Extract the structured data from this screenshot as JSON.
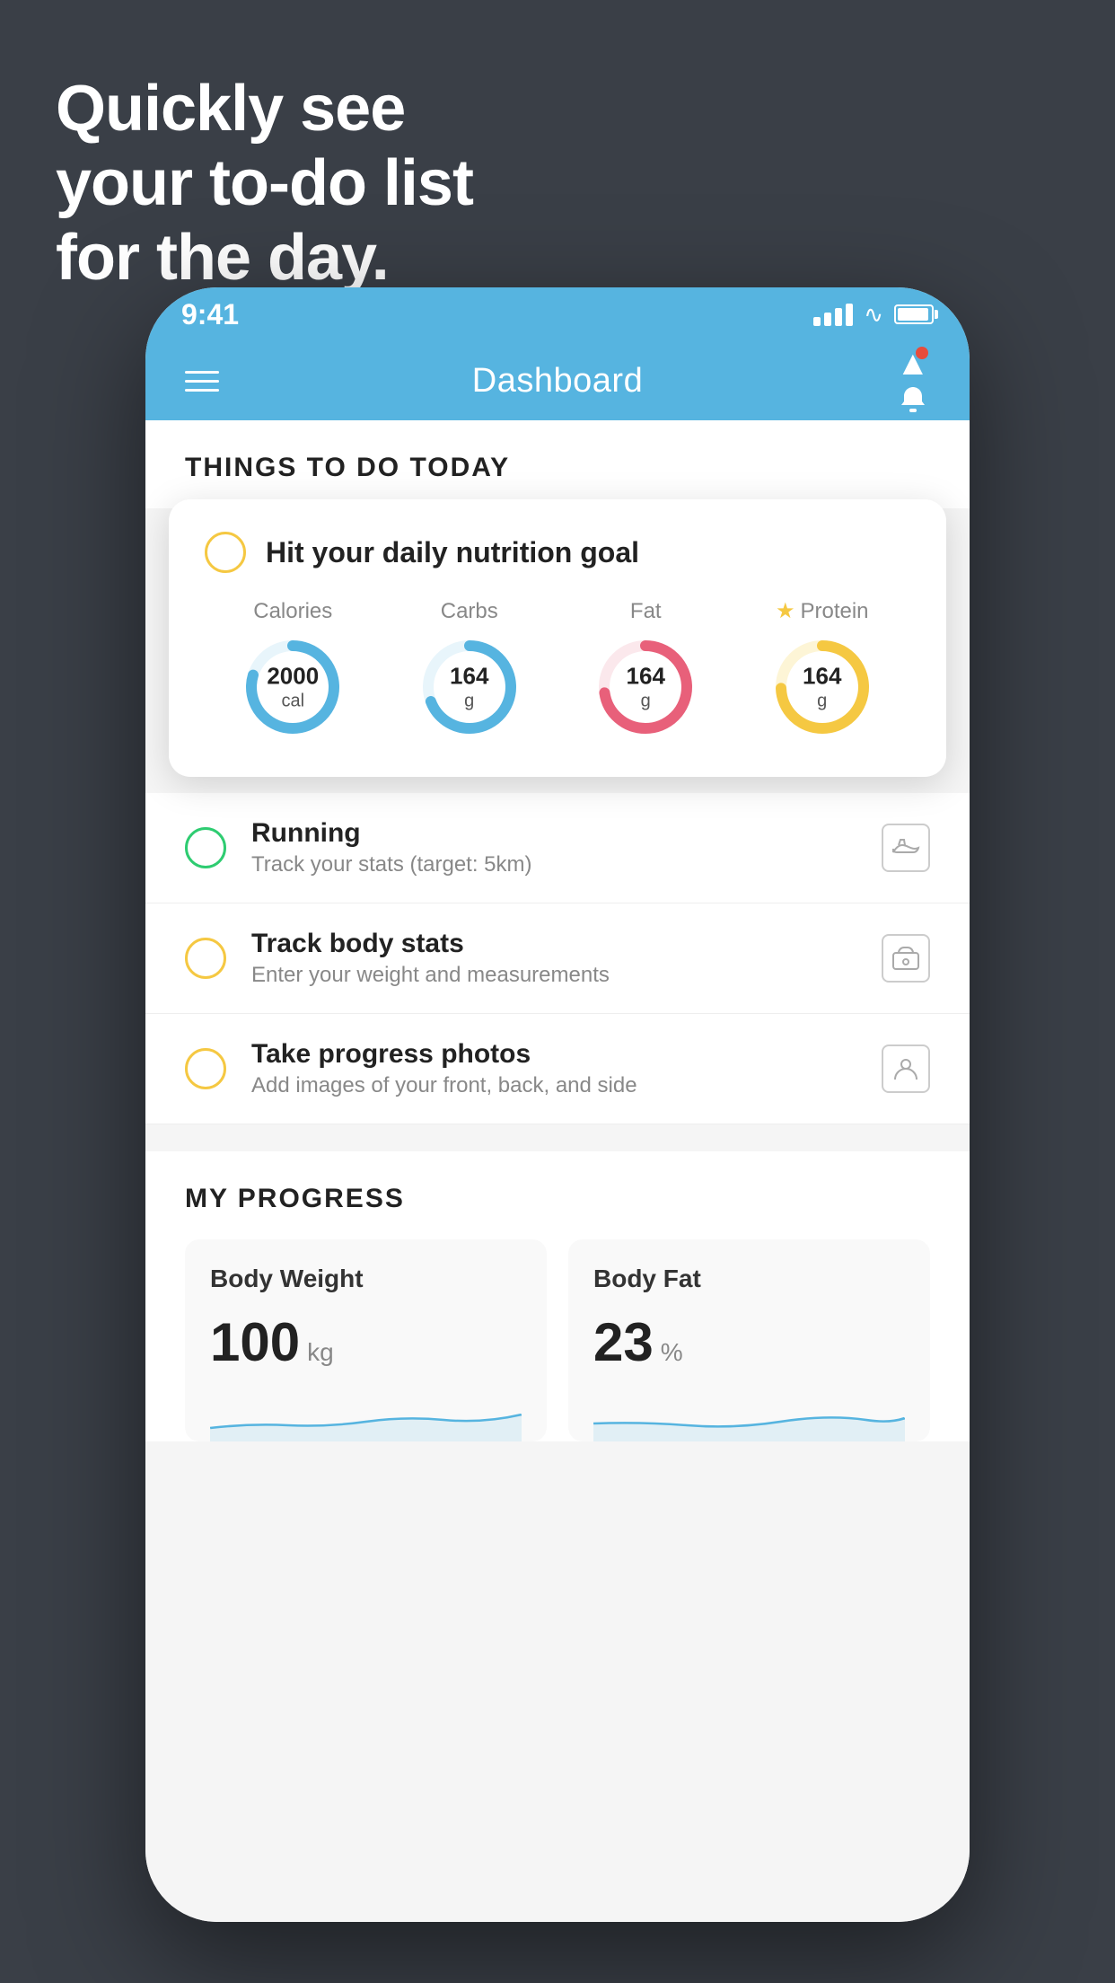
{
  "headline": {
    "line1": "Quickly see",
    "line2": "your to-do list",
    "line3": "for the day."
  },
  "statusBar": {
    "time": "9:41"
  },
  "header": {
    "title": "Dashboard"
  },
  "thingsToDo": {
    "sectionTitle": "THINGS TO DO TODAY",
    "nutritionCard": {
      "title": "Hit your daily nutrition goal",
      "stats": [
        {
          "label": "Calories",
          "value": "2000",
          "unit": "cal",
          "color": "#56b4e0",
          "starred": false
        },
        {
          "label": "Carbs",
          "value": "164",
          "unit": "g",
          "color": "#56b4e0",
          "starred": false
        },
        {
          "label": "Fat",
          "value": "164",
          "unit": "g",
          "color": "#e8607a",
          "starred": false
        },
        {
          "label": "Protein",
          "value": "164",
          "unit": "g",
          "color": "#f5c842",
          "starred": true
        }
      ]
    },
    "items": [
      {
        "title": "Running",
        "subtitle": "Track your stats (target: 5km)",
        "checkColor": "green",
        "icon": "shoe"
      },
      {
        "title": "Track body stats",
        "subtitle": "Enter your weight and measurements",
        "checkColor": "yellow",
        "icon": "scale"
      },
      {
        "title": "Take progress photos",
        "subtitle": "Add images of your front, back, and side",
        "checkColor": "yellow",
        "icon": "person"
      }
    ]
  },
  "progress": {
    "sectionTitle": "MY PROGRESS",
    "cards": [
      {
        "title": "Body Weight",
        "value": "100",
        "unit": "kg"
      },
      {
        "title": "Body Fat",
        "value": "23",
        "unit": "%"
      }
    ]
  }
}
